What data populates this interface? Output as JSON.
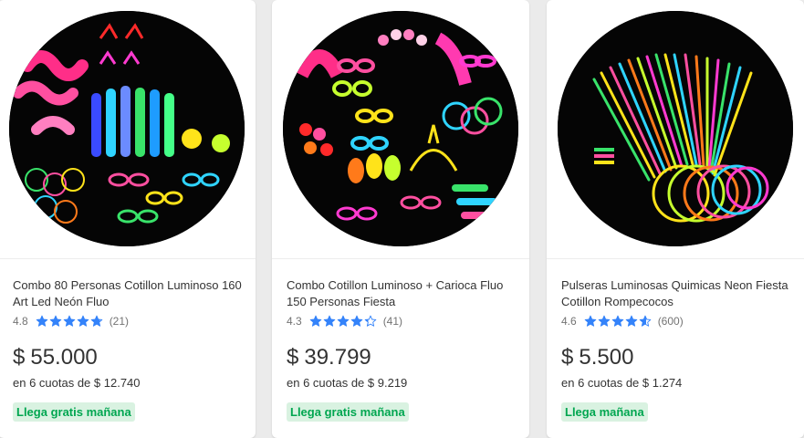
{
  "products": [
    {
      "title": "Combo 80 Personas Cotillon Luminoso 160 Art Led Neón Fluo",
      "rating": "4.8",
      "stars": 4.8,
      "reviews": "(21)",
      "currency": "$",
      "price": "55.000",
      "installments": "en 6 cuotas de $ 12.740",
      "shipping": "Llega gratis mañana"
    },
    {
      "title": "Combo Cotillon Luminoso + Carioca Fluo 150 Personas Fiesta",
      "rating": "4.3",
      "stars": 4.3,
      "reviews": "(41)",
      "currency": "$",
      "price": "39.799",
      "installments": "en 6 cuotas de $ 9.219",
      "shipping": "Llega gratis mañana"
    },
    {
      "title": "Pulseras Luminosas Quimicas Neon Fiesta Cotillon Rompecocos",
      "rating": "4.6",
      "stars": 4.6,
      "reviews": "(600)",
      "currency": "$",
      "price": "5.500",
      "installments": "en 6 cuotas de $ 1.274",
      "shipping": "Llega mañana"
    }
  ],
  "colors": {
    "star": "#3483fa",
    "shipping_text": "#00a650",
    "shipping_bg": "#d9f2e1"
  }
}
